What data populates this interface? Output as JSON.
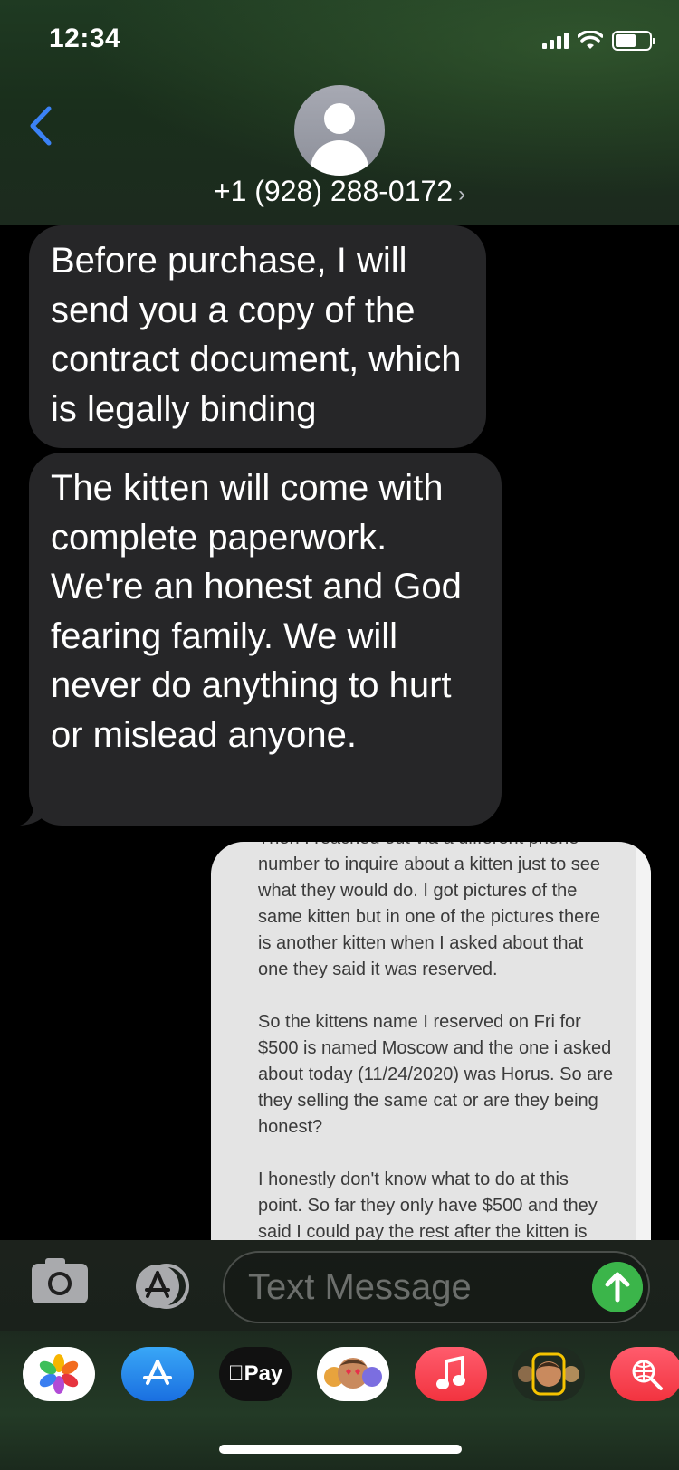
{
  "status_bar": {
    "time": "12:34"
  },
  "header": {
    "contact_number": "+1 (928) 288-0172",
    "contact_chevron": "›"
  },
  "messages": [
    {
      "direction": "incoming",
      "text": "Before purchase, I will send you a copy of the contract document, which is legally binding"
    },
    {
      "direction": "incoming",
      "text": "The kitten will come with complete paperwork. We're an honest and God fearing family. We will never do anything to hurt or mislead anyone."
    }
  ],
  "outgoing_image": {
    "paragraphs": [
      "Then I reached out via a different phone number to inquire about a kitten just to see what they would do. I got pictures of the same kitten but in one of the pictures there is another kitten when I asked about that one they said it was reserved.",
      "So the kittens name I reserved on Fri for $500 is named Moscow and the one i asked about today (11/24/2020) was Horus. So are they selling the same cat or are they being honest?",
      "I honestly don't know what to do at this point. So far they only have $500 and they said I could pay the rest after the kitten is"
    ]
  },
  "composer": {
    "placeholder": "Text Message"
  },
  "app_drawer": {
    "apps": [
      {
        "name": "photos",
        "icon": "photos-icon"
      },
      {
        "name": "app-store",
        "icon": "app-store-icon"
      },
      {
        "name": "apple-pay",
        "label": "Pay",
        "icon": "apple-pay-icon"
      },
      {
        "name": "animoji",
        "icon": "animoji-icon"
      },
      {
        "name": "music",
        "icon": "music-icon"
      },
      {
        "name": "memoji",
        "icon": "memoji-icon"
      },
      {
        "name": "web-search",
        "icon": "globe-search-icon"
      }
    ]
  },
  "colors": {
    "incoming_bubble": "#262628",
    "send_button": "#3bb54a",
    "back_chevron": "#3b82f6"
  }
}
